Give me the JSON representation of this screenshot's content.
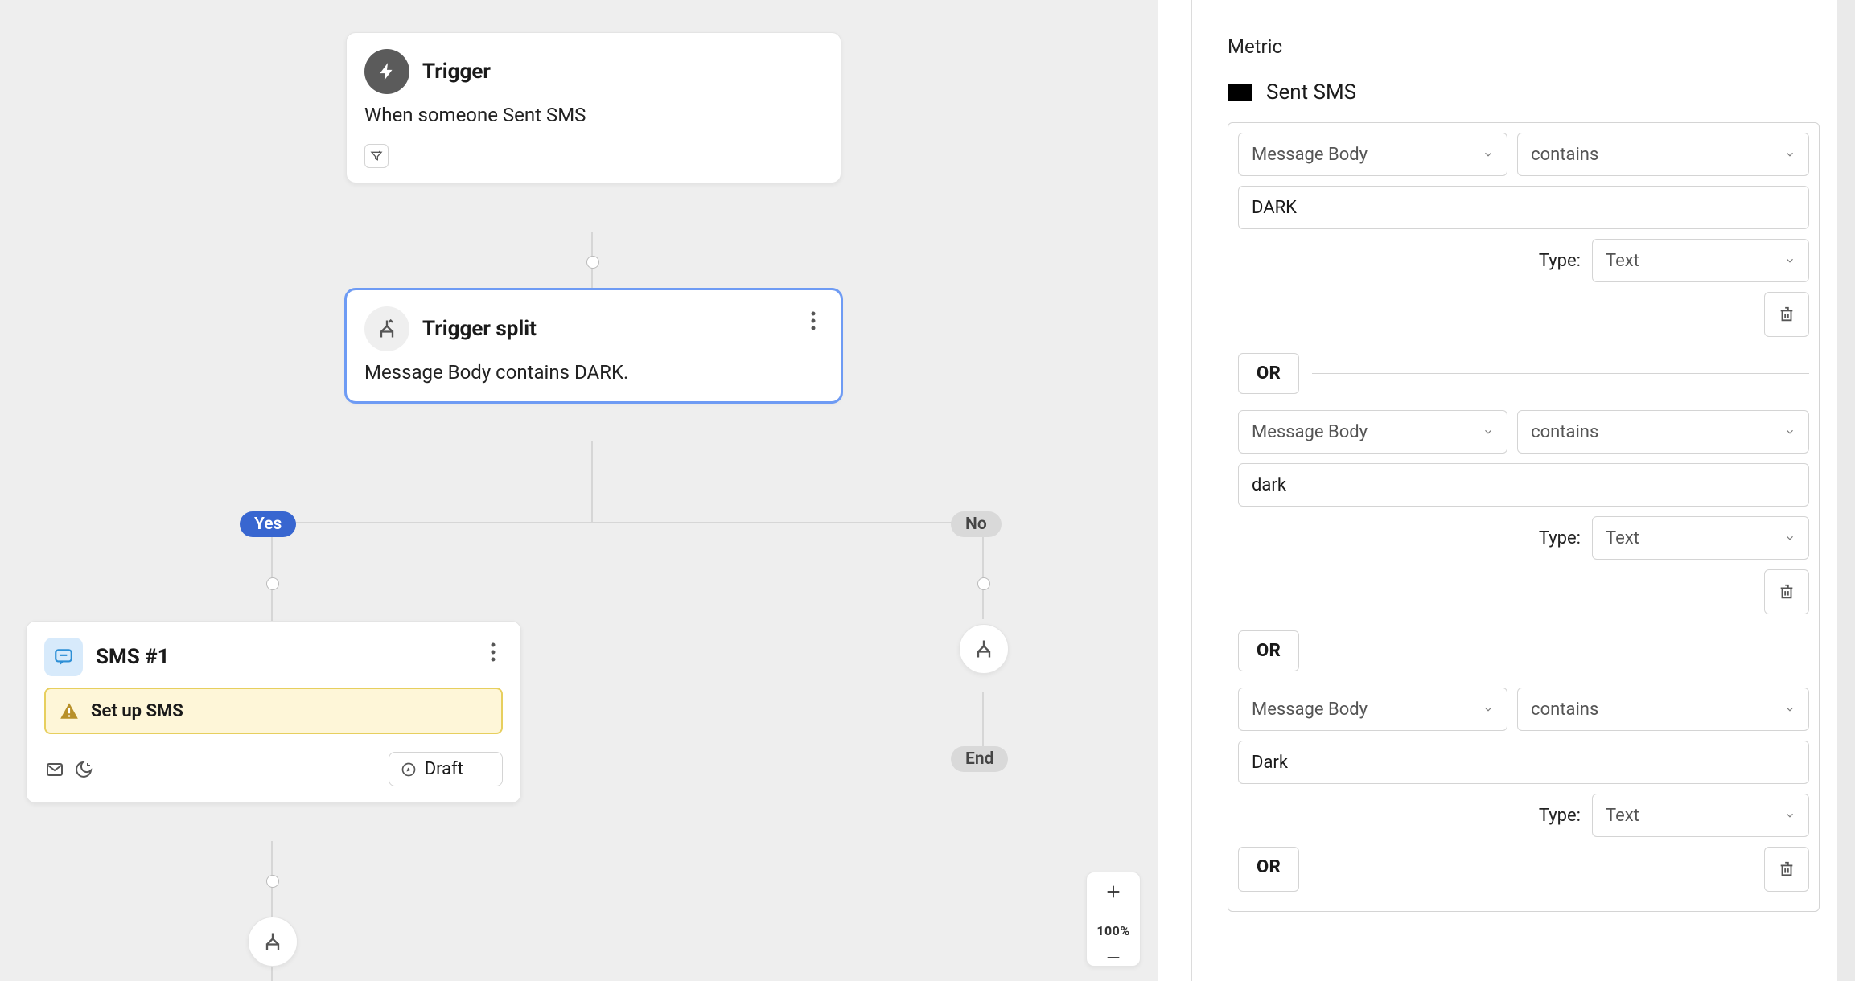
{
  "canvas": {
    "trigger": {
      "title": "Trigger",
      "line": "When someone Sent SMS"
    },
    "split": {
      "title": "Trigger split",
      "line": "Message Body contains DARK."
    },
    "branches": {
      "yes": "Yes",
      "no": "No",
      "end": "End"
    },
    "sms": {
      "title": "SMS #1",
      "warning": "Set up SMS",
      "status": "Draft"
    },
    "zoom": "100%"
  },
  "panel": {
    "section_label": "Metric",
    "metric_name": "Sent SMS",
    "type_label": "Type:",
    "or_label": "OR",
    "conditions": [
      {
        "field": "Message Body",
        "op": "contains",
        "value": "DARK",
        "type": "Text"
      },
      {
        "field": "Message Body",
        "op": "contains",
        "value": "dark",
        "type": "Text"
      },
      {
        "field": "Message Body",
        "op": "contains",
        "value": "Dark",
        "type": "Text"
      }
    ]
  }
}
